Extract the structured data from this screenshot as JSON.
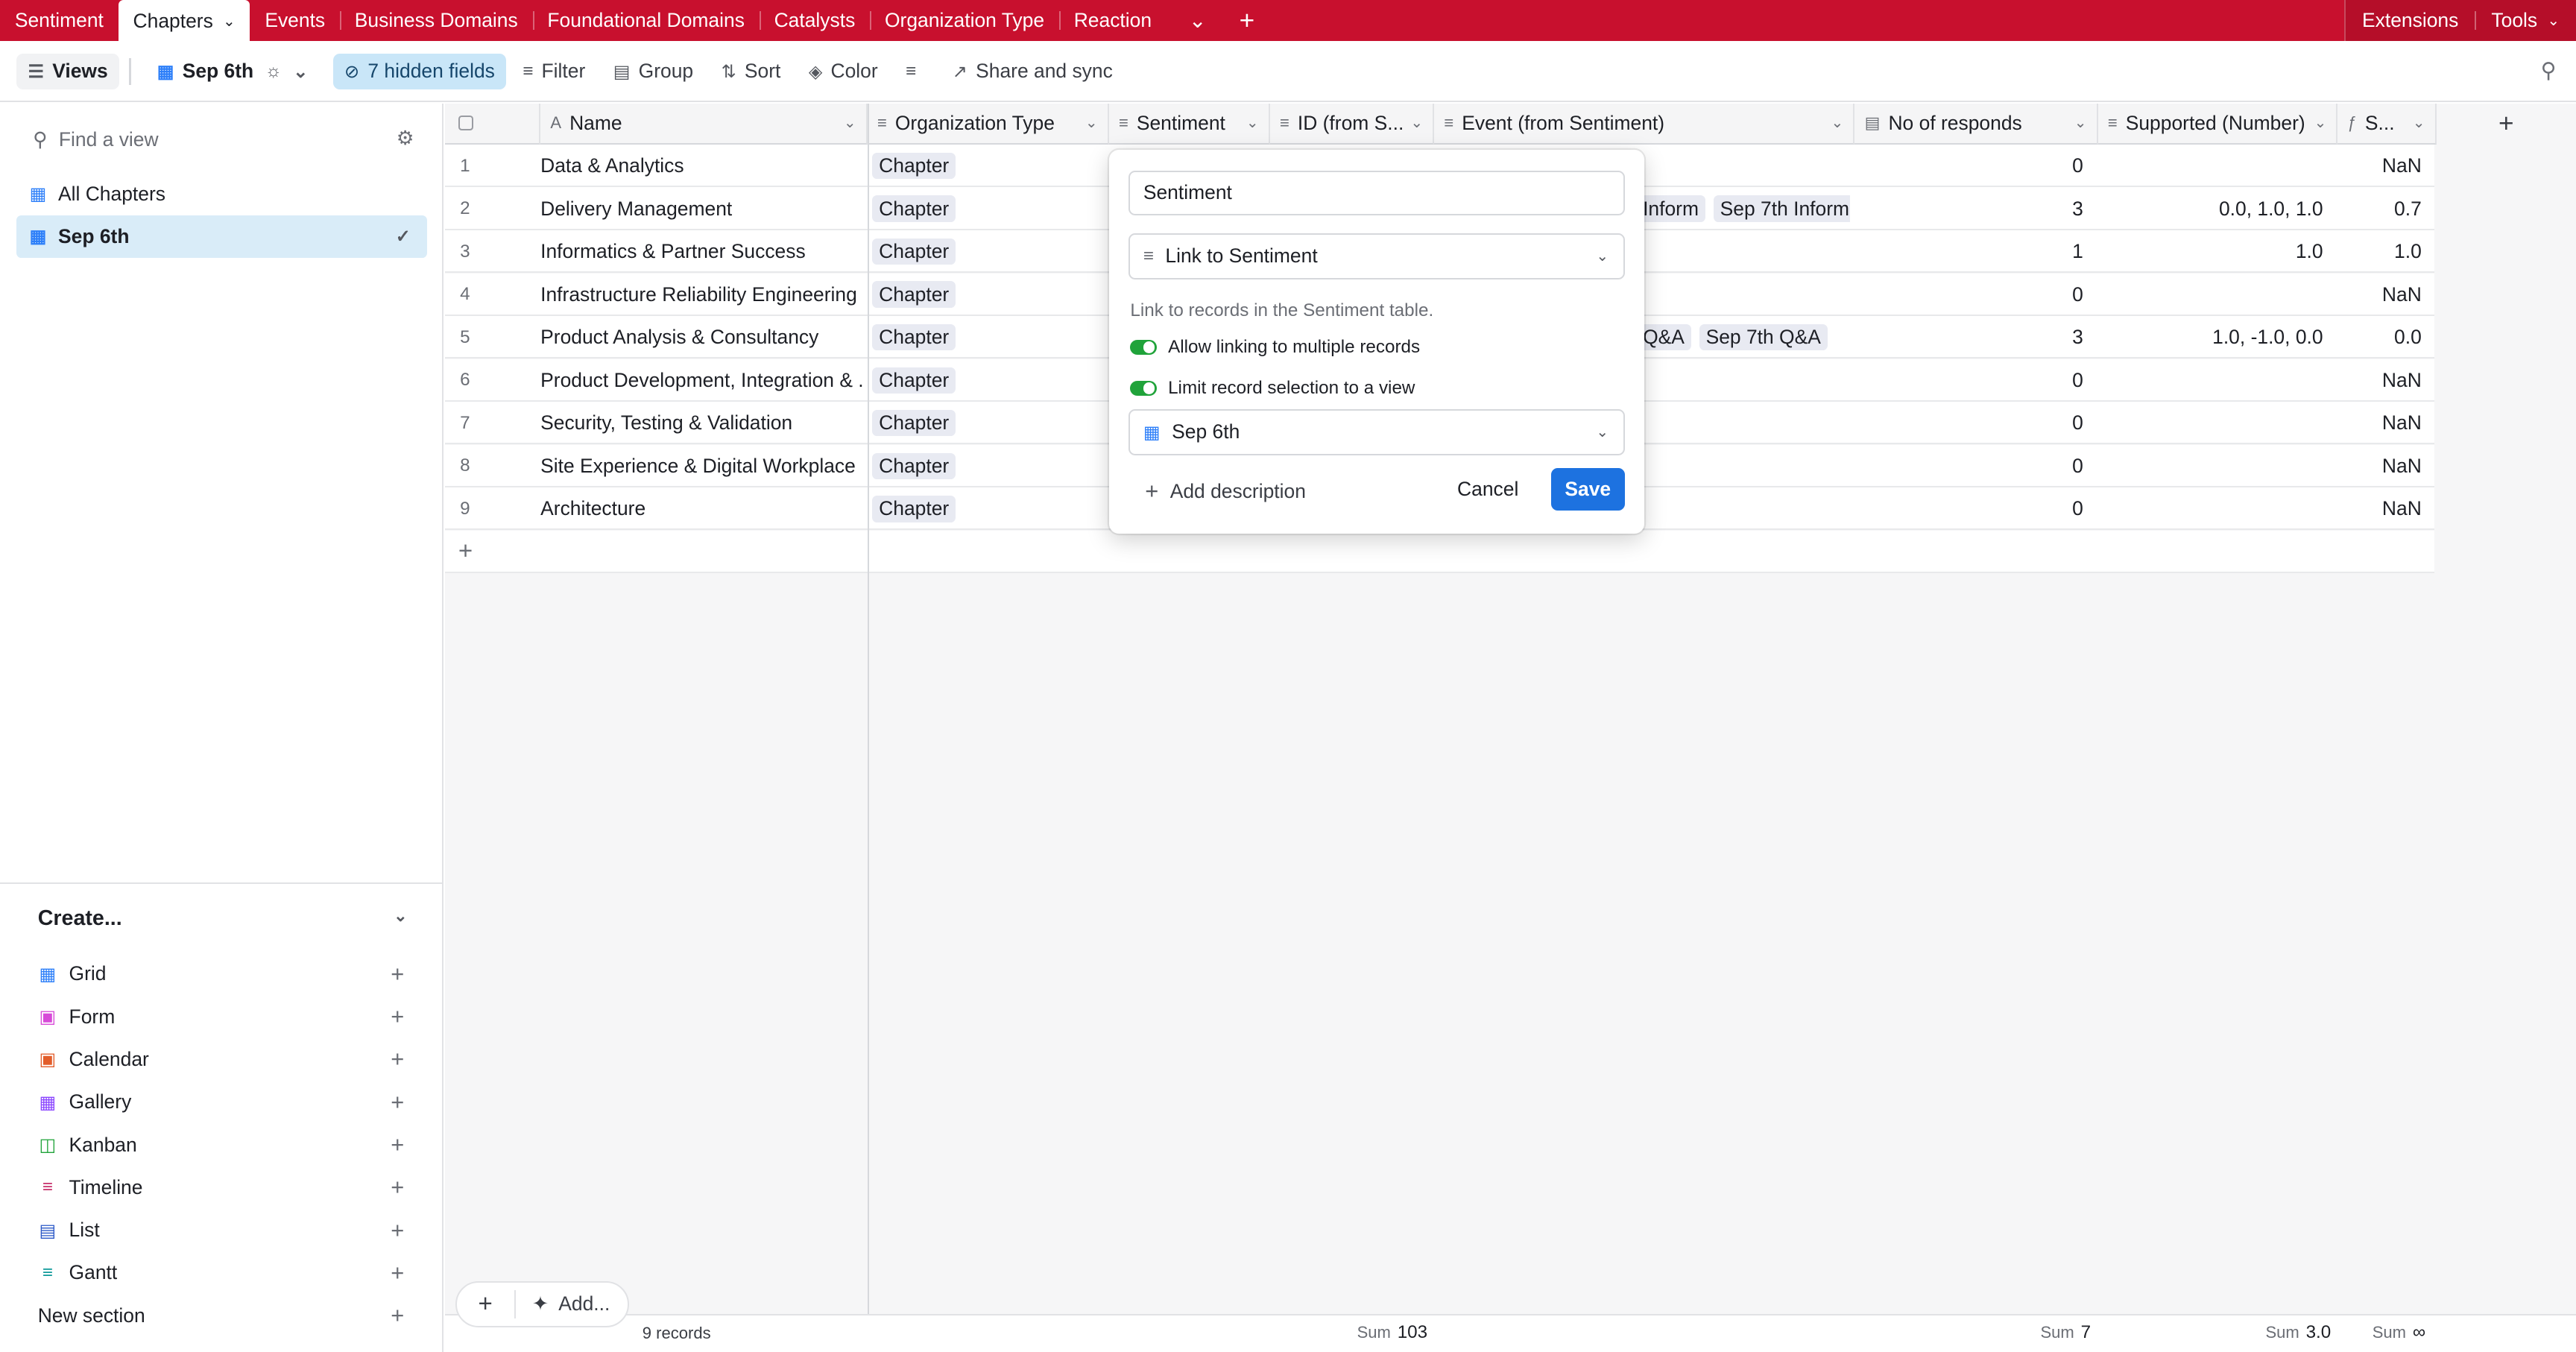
{
  "top_tabs": [
    "Sentiment",
    "Chapters",
    "Events",
    "Business Domains",
    "Foundational Domains",
    "Catalysts",
    "Organization Type",
    "Reaction"
  ],
  "active_tab_index": 1,
  "top_right": {
    "extensions": "Extensions",
    "tools": "Tools"
  },
  "toolbar": {
    "views": "Views",
    "view_name": "Sep 6th",
    "hidden_fields": "7 hidden fields",
    "filter": "Filter",
    "group": "Group",
    "sort": "Sort",
    "color": "Color",
    "share": "Share and sync"
  },
  "sidebar": {
    "find_placeholder": "Find a view",
    "views": [
      {
        "label": "All Chapters",
        "selected": false
      },
      {
        "label": "Sep 6th",
        "selected": true
      }
    ],
    "create_title": "Create...",
    "create_items": [
      {
        "label": "Grid",
        "icon": "grid-icon",
        "color": "#2d7ff9"
      },
      {
        "label": "Form",
        "icon": "form-icon",
        "color": "#d74ad8"
      },
      {
        "label": "Calendar",
        "icon": "calendar-icon",
        "color": "#e25d2a"
      },
      {
        "label": "Gallery",
        "icon": "gallery-icon",
        "color": "#8b46ff"
      },
      {
        "label": "Kanban",
        "icon": "kanban-icon",
        "color": "#20a33a"
      },
      {
        "label": "Timeline",
        "icon": "timeline-icon",
        "color": "#c7306b"
      },
      {
        "label": "List",
        "icon": "list-icon",
        "color": "#2b58c7"
      },
      {
        "label": "Gantt",
        "icon": "gantt-icon",
        "color": "#0f9a9a"
      }
    ],
    "new_section": "New section"
  },
  "columns": {
    "name": "Name",
    "org_type": "Organization Type",
    "sentiment": "Sentiment",
    "id_from": "ID (from S...",
    "event_from": "Event (from Sentiment)",
    "responds": "No of responds",
    "supported": "Supported (Number)",
    "s_formula": "S..."
  },
  "rows": [
    {
      "num": "1",
      "name": "Data & Analytics",
      "org": "Chapter",
      "events": [],
      "responds": "0",
      "supported": "",
      "s": "NaN"
    },
    {
      "num": "2",
      "name": "Delivery Management",
      "org": "Chapter",
      "events": [
        "Inform",
        "Sep 7th Inform"
      ],
      "responds": "3",
      "supported": "0.0, 1.0, 1.0",
      "s": "0.7"
    },
    {
      "num": "3",
      "name": "Informatics & Partner Success",
      "org": "Chapter",
      "events": [],
      "responds": "1",
      "supported": "1.0",
      "s": "1.0"
    },
    {
      "num": "4",
      "name": "Infrastructure Reliability Engineering",
      "org": "Chapter",
      "events": [],
      "responds": "0",
      "supported": "",
      "s": "NaN"
    },
    {
      "num": "5",
      "name": "Product Analysis & Consultancy",
      "org": "Chapter",
      "events": [
        "Q&A",
        "Sep 7th Q&A"
      ],
      "responds": "3",
      "supported": "1.0, -1.0, 0.0",
      "s": "0.0"
    },
    {
      "num": "6",
      "name": "Product Development, Integration & ...",
      "org": "Chapter",
      "events": [],
      "responds": "0",
      "supported": "",
      "s": "NaN"
    },
    {
      "num": "7",
      "name": "Security, Testing & Validation",
      "org": "Chapter",
      "events": [],
      "responds": "0",
      "supported": "",
      "s": "NaN"
    },
    {
      "num": "8",
      "name": "Site Experience & Digital Workplace",
      "org": "Chapter",
      "events": [],
      "responds": "0",
      "supported": "",
      "s": "NaN"
    },
    {
      "num": "9",
      "name": "Architecture",
      "org": "Chapter",
      "events": [],
      "responds": "0",
      "supported": "",
      "s": "NaN"
    }
  ],
  "footer": {
    "add_label": "Add...",
    "records": "9 records",
    "sum_label": "Sum",
    "sum_event": "103",
    "sum_responds": "7",
    "sum_supported": "3.0",
    "sum_s": "∞"
  },
  "dialog": {
    "field_name": "Sentiment",
    "field_type": "Link to Sentiment",
    "description": "Link to records in the Sentiment table.",
    "toggle_multiple": "Allow linking to multiple records",
    "toggle_limit": "Limit record selection to a view",
    "view_select": "Sep 6th",
    "add_description": "Add description",
    "cancel": "Cancel",
    "save": "Save"
  }
}
